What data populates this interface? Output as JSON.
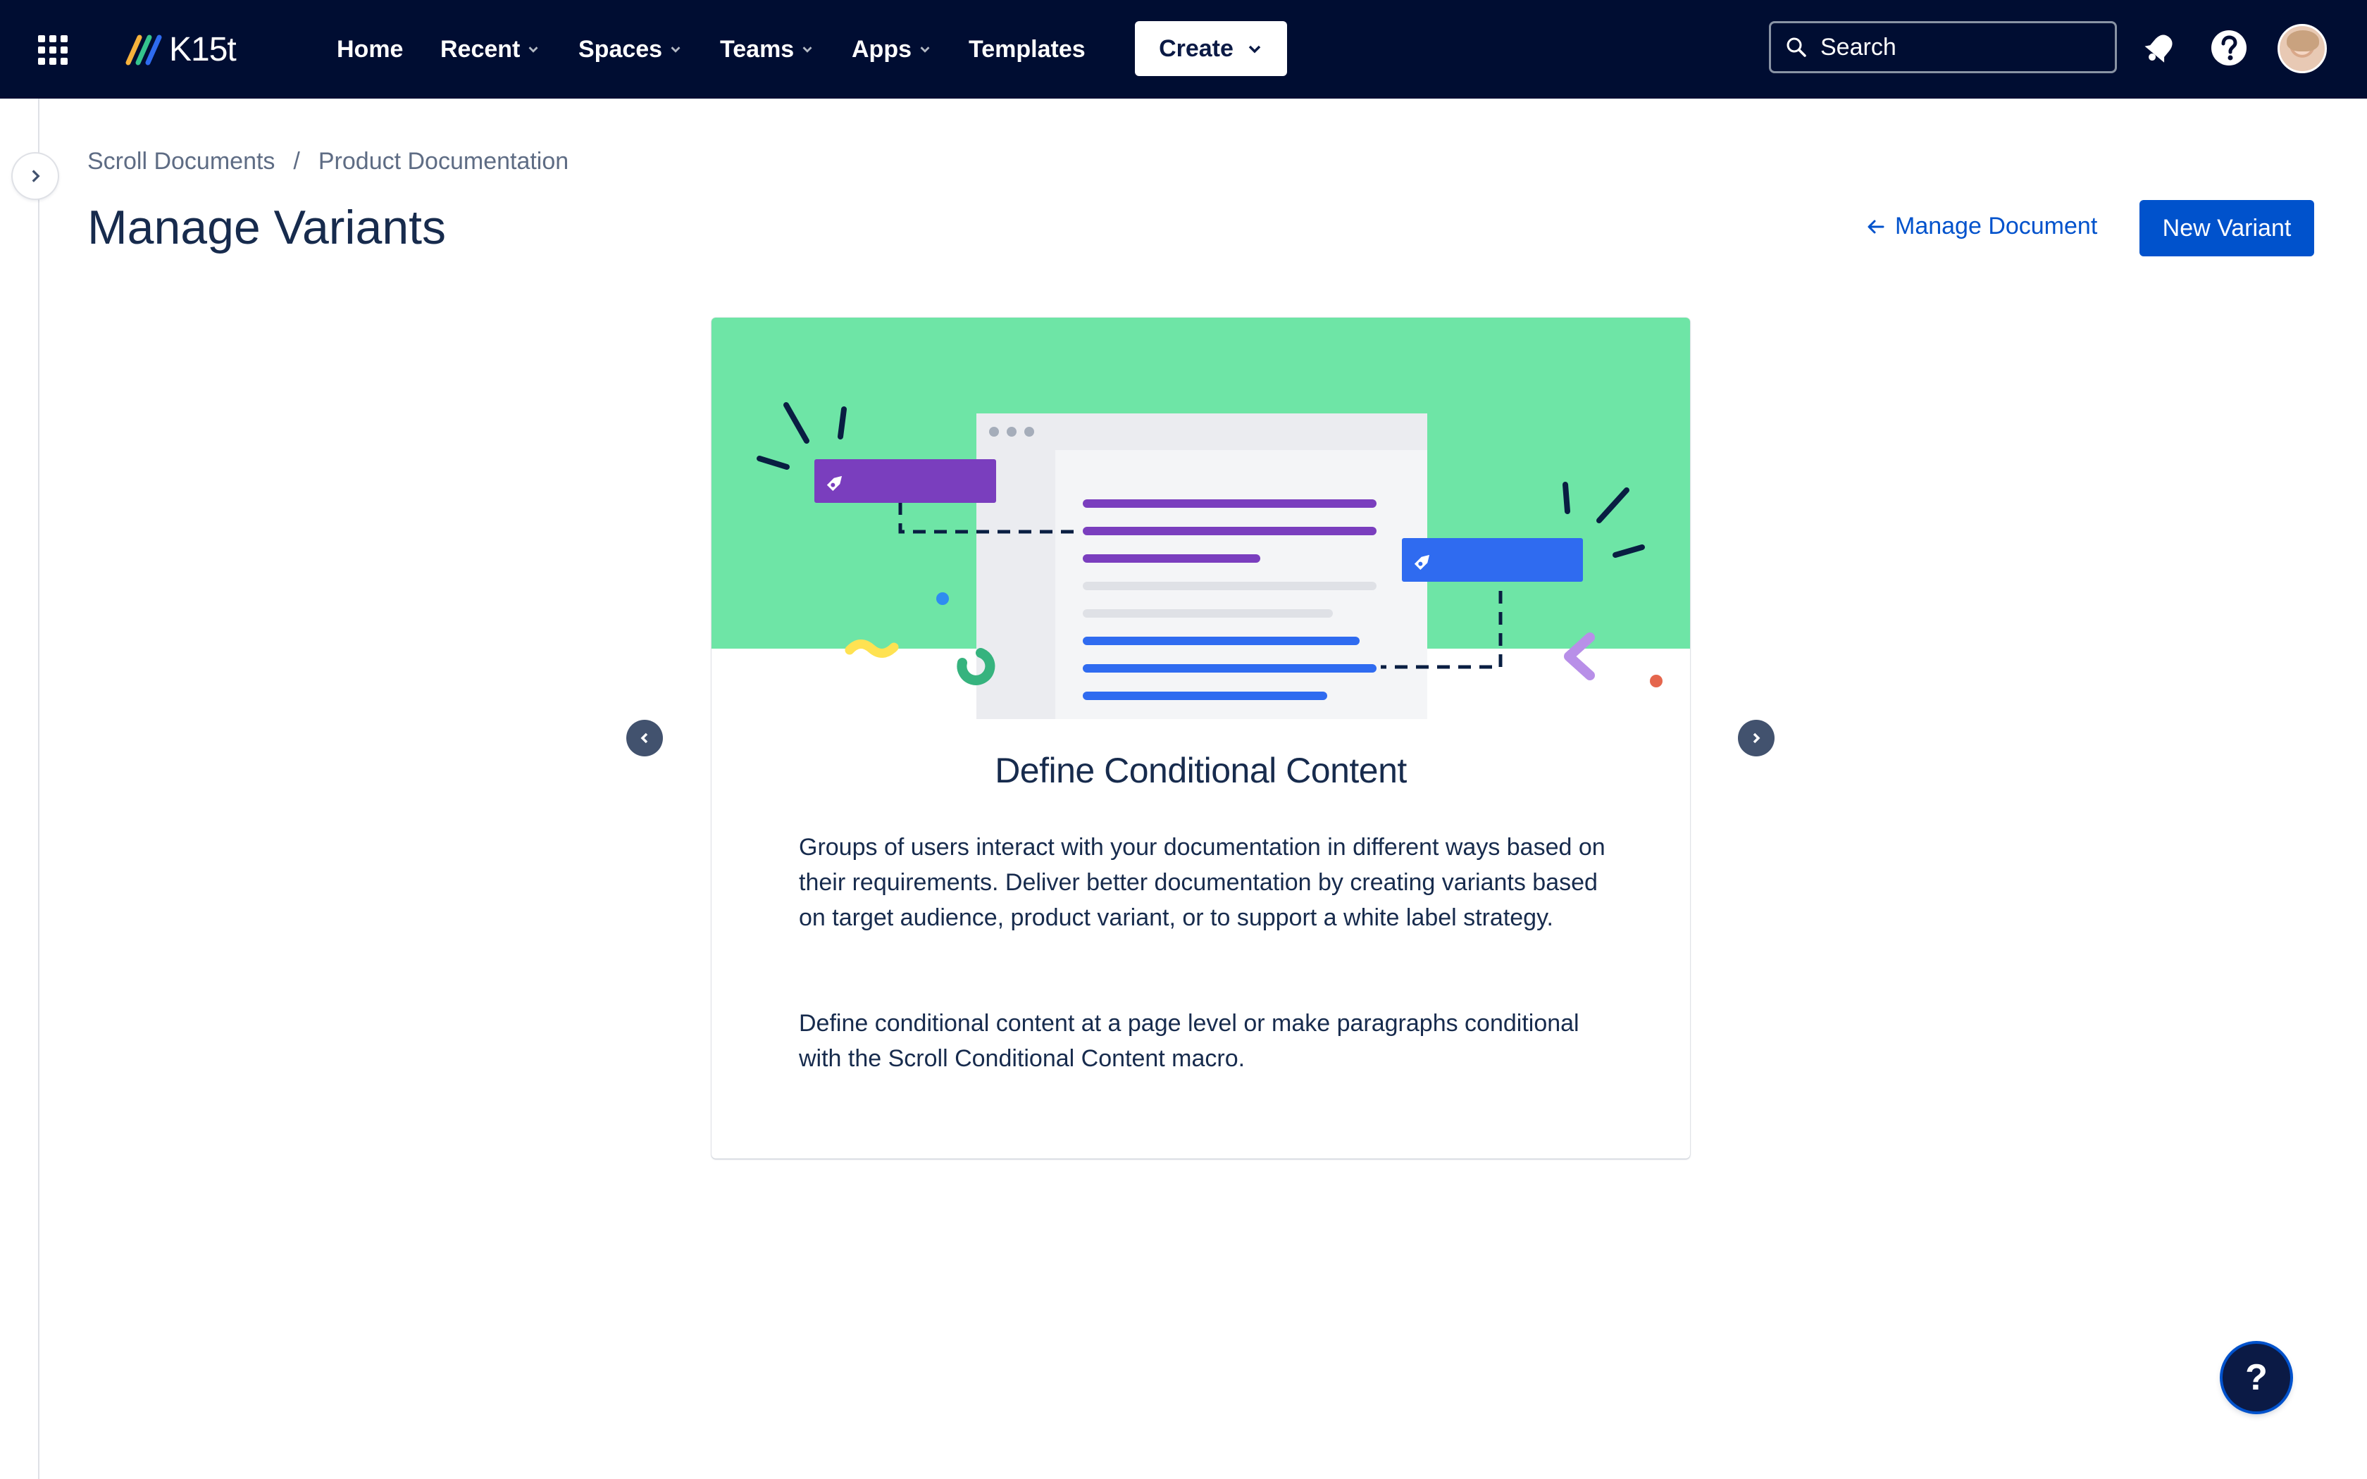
{
  "topnav": {
    "logo_text": "K15t",
    "items": [
      {
        "label": "Home",
        "has_dropdown": false
      },
      {
        "label": "Recent",
        "has_dropdown": true
      },
      {
        "label": "Spaces",
        "has_dropdown": true
      },
      {
        "label": "Teams",
        "has_dropdown": true
      },
      {
        "label": "Apps",
        "has_dropdown": true
      },
      {
        "label": "Templates",
        "has_dropdown": false
      }
    ],
    "create_label": "Create",
    "search_placeholder": "Search",
    "icons": {
      "apps": "app-switcher-icon",
      "notifications": "notification-bell-icon",
      "help": "help-icon",
      "search": "search-icon"
    }
  },
  "breadcrumb": {
    "items": [
      "Scroll Documents",
      "Product Documentation"
    ],
    "separator": "/"
  },
  "page": {
    "title": "Manage Variants",
    "manage_document_label": "Manage Document",
    "new_variant_label": "New Variant"
  },
  "card": {
    "heading": "Define Conditional Content",
    "paragraph_1": "Groups of users interact with your documentation in different ways based on their requirements. Deliver better documentation by creating variants based on target audience, product variant, or to support a white label strategy.",
    "paragraph_2": "Define conditional content at a page level or make paragraphs conditional with the Scroll Conditional Content macro."
  },
  "help_fab": {
    "label": "?"
  },
  "colors": {
    "nav_bg": "#000D32",
    "primary": "#0052CC",
    "illustration_green": "#6EE5A6",
    "tag_purple": "#7A3EBE",
    "tag_blue": "#2F6BF0",
    "text": "#172B4D",
    "muted": "#5E6C84"
  }
}
